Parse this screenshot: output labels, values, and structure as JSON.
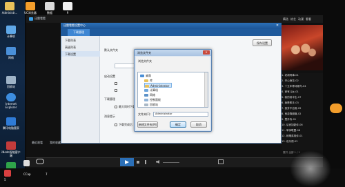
{
  "desktop": {
    "icons": [
      {
        "label": "Administr..."
      },
      {
        "label": "UC浏览器"
      },
      {
        "label": "数据"
      },
      {
        "label": "9"
      },
      {
        "label": "计算机"
      },
      {
        "label": "网络"
      },
      {
        "label": "Internet Explorer"
      },
      {
        "label": "回收站"
      },
      {
        "label": "腾讯电脑管家"
      },
      {
        "label": "iNode智能客户端"
      },
      {
        "label": "4.3"
      },
      {
        "label": "软件管家"
      },
      {
        "label": "CCap"
      },
      {
        "label": "7"
      },
      {
        "label": "5"
      }
    ]
  },
  "player": {
    "title": "迅雷看看",
    "tabs": [
      "精选",
      "综艺",
      "动漫",
      "看看"
    ],
    "bottom_links": [
      "最近观看",
      "我的收藏"
    ],
    "right_list": [
      "1. 老胡同事-01",
      "2. 开心麻花-02",
      "3. 十五年等待候鸟-04",
      "4. 家有儿女-01",
      "5. 我的前半生-07",
      "6. 我是歌手-03",
      "7. 孤芳不自赏-05",
      "8. 西游降魔篇-02",
      "9. 楚乔传-01",
      "10. 后宫如懿传-06",
      "11. 军师联盟-08",
      "12. 射雕英雄传-01",
      "13. 欢乐颂-02"
    ],
    "right_bottom": "展开 全部  1 / 1"
  },
  "settings": {
    "window_title": "迅雷看看设置中心",
    "tab_active": "下载管理",
    "sidebar": [
      "下载列表",
      "高级列表",
      "下载设置"
    ],
    "save_button": "保存设置",
    "sections": [
      {
        "heading": "默认文件夹"
      },
      {
        "heading": "启动设置"
      },
      {
        "heading": "下载管理"
      },
      {
        "heading": "消息提示"
      }
    ],
    "options": [
      "最大同时下载任务数",
      "下载完成后"
    ]
  },
  "dialog": {
    "title": "浏览文件夹",
    "instruction": "浏览文件夹",
    "tree": [
      {
        "label": "桌面",
        "indent": 0
      },
      {
        "label": "库",
        "indent": 1
      },
      {
        "label": "Administrator",
        "indent": 1,
        "selected": true
      },
      {
        "label": "计算机",
        "indent": 1
      },
      {
        "label": "网络",
        "indent": 1
      },
      {
        "label": "控制面板",
        "indent": 1
      },
      {
        "label": "回收站",
        "indent": 1
      }
    ],
    "folder_label": "文件夹(F):",
    "folder_value": "Administrator",
    "new_folder_button": "新建文件夹(M)",
    "ok_button": "确定",
    "cancel_button": "取消"
  },
  "taskbar": {
    "time": "7"
  }
}
